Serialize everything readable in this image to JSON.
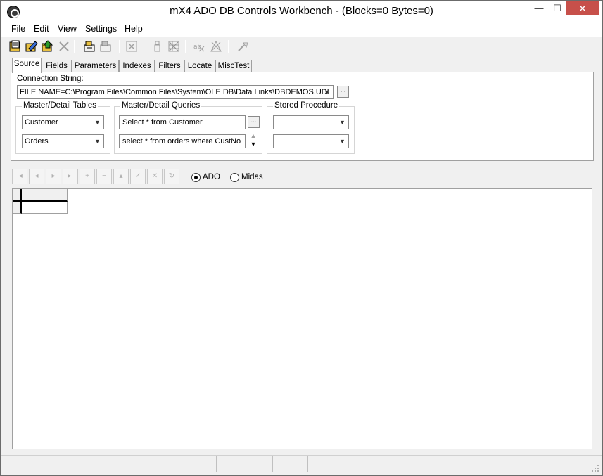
{
  "window": {
    "title": "mX4 ADO DB Controls Workbench - (Blocks=0 Bytes=0)",
    "minimize_glyph": "—",
    "maximize_glyph": "☐",
    "close_glyph": "✕"
  },
  "menu": {
    "items": [
      "File",
      "Edit",
      "View",
      "Settings",
      "Help"
    ]
  },
  "toolbar": {
    "icons": [
      "open-folder-icon",
      "edit-pencil-icon",
      "open-file-icon",
      "delete-x-icon",
      "connect-icon",
      "disconnect-icon",
      "cancel-box-icon",
      "bottle-icon",
      "grid-delete-icon",
      "edit-delete-icon",
      "clear-icon",
      "brush-icon"
    ]
  },
  "tabs": [
    "Source",
    "Fields",
    "Parameters",
    "Indexes",
    "Filters",
    "Locate",
    "MiscTest"
  ],
  "source": {
    "connection_label": "Connection String:",
    "connection_value": "FILE NAME=C:\\Program Files\\Common Files\\System\\OLE DB\\Data Links\\DBDEMOS.UDL",
    "browse_label": "...",
    "tables_group": "Master/Detail Tables",
    "master_table": "Customer",
    "detail_table": "Orders",
    "queries_group": "Master/Detail Queries",
    "master_query": "Select * from Customer",
    "detail_query": "select * from orders where CustNo",
    "query_browse_label": "...",
    "stored_group": "Stored Procedure",
    "stored_1": "",
    "stored_2": ""
  },
  "navigator": {
    "buttons": [
      "first",
      "prior",
      "next",
      "last",
      "insert",
      "delete",
      "edit",
      "post",
      "cancel",
      "refresh"
    ]
  },
  "radios": {
    "ado_label": "ADO",
    "midas_label": "Midas",
    "selected": "ADO"
  },
  "colors": {
    "close_button": "#c7504a",
    "window_bg": "#f0f0f0"
  }
}
